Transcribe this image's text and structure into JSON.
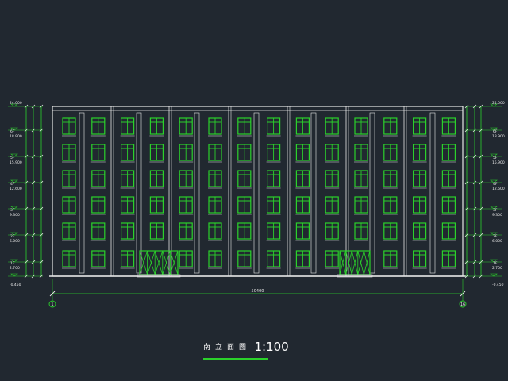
{
  "drawing": {
    "title": "南立面图",
    "scale": "1:100",
    "overall_dimension": "50400",
    "axis_left": "1",
    "axis_right": "16",
    "floors": 6,
    "bays_per_floor": 14,
    "entrance_count": 2
  },
  "elevation_labels": {
    "top": "24.000",
    "levels": [
      "18.900",
      "15.900",
      "12.600",
      "9.300",
      "6.000",
      "2.700",
      "-0.450"
    ],
    "floor_tags": [
      "6F",
      "5F",
      "4F",
      "3F",
      "2F",
      "1F"
    ]
  },
  "colors": {
    "background": "#212830",
    "lines": "#ffffff",
    "windows": "#2bd12b",
    "dimensions": "#2bd12b",
    "frame_white": "#e8e8e8"
  }
}
